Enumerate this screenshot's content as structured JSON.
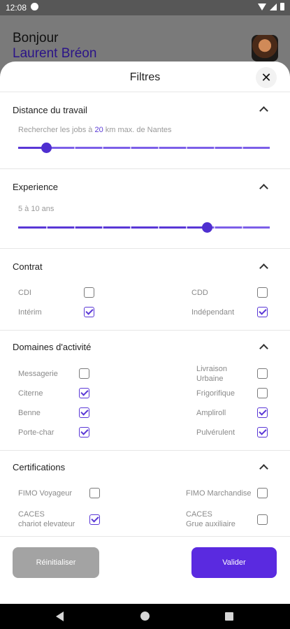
{
  "status": {
    "time": "12:08"
  },
  "header": {
    "greeting": "Bonjour",
    "name": "Laurent Bréon"
  },
  "sheet": {
    "title": "Filtres",
    "close": "✕"
  },
  "distance": {
    "title": "Distance du travail",
    "hint_before": "Rechercher les jobs à ",
    "hint_value": "20",
    "hint_after": " km max. de Nantes",
    "slider_fraction": 0.11
  },
  "experience": {
    "title": "Experience",
    "hint": "5 à 10 ans",
    "slider_fraction": 0.75
  },
  "contrat": {
    "title": "Contrat",
    "options": [
      {
        "label": "CDI",
        "checked": false
      },
      {
        "label": "CDD",
        "checked": false
      },
      {
        "label": "Intérim",
        "checked": true
      },
      {
        "label": "Indépendant",
        "checked": true
      }
    ]
  },
  "domaines": {
    "title": "Domaines d'activité",
    "options": [
      {
        "label": "Messagerie",
        "checked": false
      },
      {
        "label": "Livraison Urbaine",
        "checked": false
      },
      {
        "label": "Citerne",
        "checked": true
      },
      {
        "label": "Frigorifique",
        "checked": false
      },
      {
        "label": "Benne",
        "checked": true
      },
      {
        "label": "Ampliroll",
        "checked": true
      },
      {
        "label": "Porte-char",
        "checked": true
      },
      {
        "label": "Pulvérulent",
        "checked": true
      }
    ]
  },
  "certifications": {
    "title": "Certifications",
    "options": [
      {
        "label": "FIMO Voyageur",
        "checked": false
      },
      {
        "label": "FIMO Marchandise",
        "checked": false
      },
      {
        "label_line1": "CACES",
        "label_line2": "chariot elevateur",
        "checked": true
      },
      {
        "label_line1": "CACES",
        "label_line2": "Grue auxiliaire",
        "checked": false
      }
    ]
  },
  "actions": {
    "reset": "Réinitialiser",
    "validate": "Valider"
  },
  "colors": {
    "accent": "#5a2ae0",
    "accent_text": "#2b1488"
  }
}
